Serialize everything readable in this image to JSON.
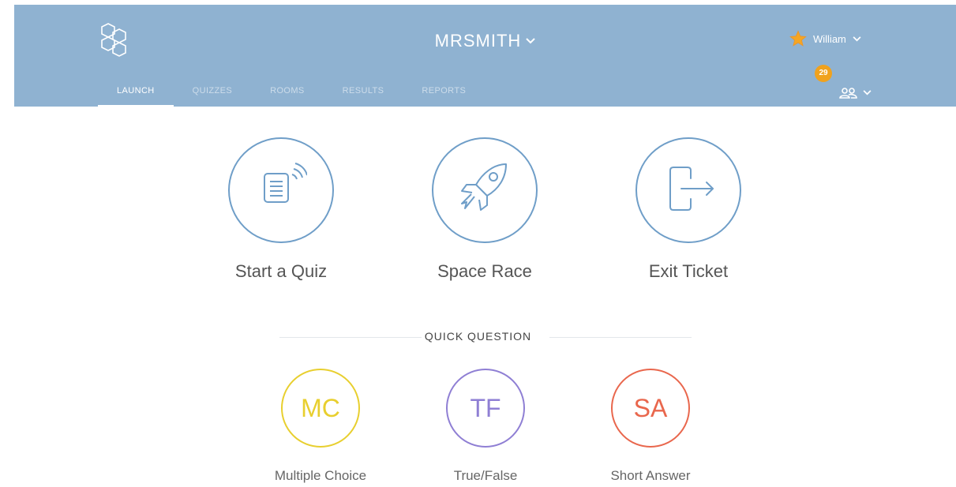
{
  "header": {
    "room_name": "MRSMITH",
    "user_name": "William",
    "student_count": "29",
    "tabs": [
      {
        "label": "LAUNCH",
        "active": true
      },
      {
        "label": "QUIZZES",
        "active": false
      },
      {
        "label": "ROOMS",
        "active": false
      },
      {
        "label": "RESULTS",
        "active": false
      },
      {
        "label": "REPORTS",
        "active": false
      }
    ]
  },
  "launch": {
    "items": [
      {
        "label": "Start a Quiz",
        "icon": "quiz-document-icon"
      },
      {
        "label": "Space Race",
        "icon": "rocket-icon"
      },
      {
        "label": "Exit Ticket",
        "icon": "exit-door-icon"
      }
    ]
  },
  "quick_question": {
    "title": "QUICK QUESTION",
    "items": [
      {
        "abbr": "MC",
        "label": "Multiple Choice",
        "color": "#e8cf2f"
      },
      {
        "abbr": "TF",
        "label": "True/False",
        "color": "#8f7fd4"
      },
      {
        "abbr": "SA",
        "label": "Short Answer",
        "color": "#e9674d"
      }
    ]
  },
  "colors": {
    "header_bg": "#8fb2d1",
    "accent_blue": "#6f9ec8",
    "badge": "#f0a21e",
    "star": "#f5a623"
  }
}
